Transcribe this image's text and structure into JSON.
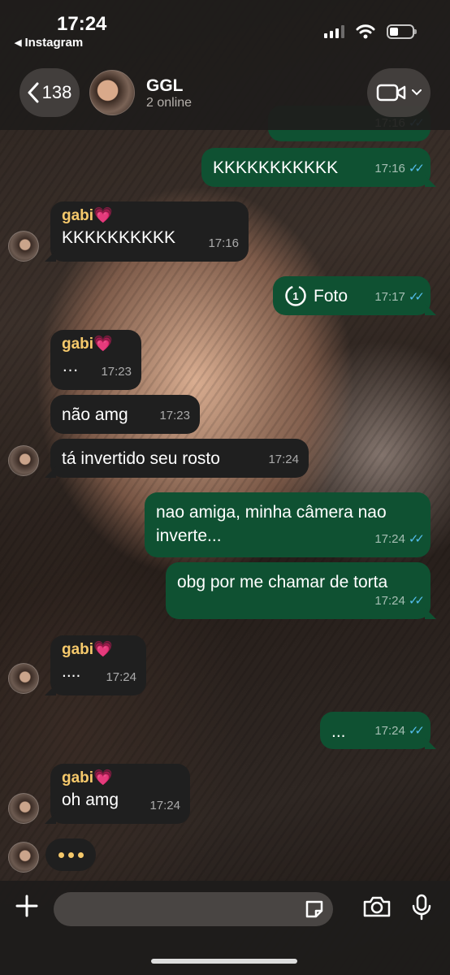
{
  "status_bar": {
    "time": "17:24",
    "back_app": "Instagram"
  },
  "chat_header": {
    "back_count": "138",
    "group_name": "GGL",
    "subtitle": "2 online"
  },
  "messages": [
    {
      "text": "KKKKKKKKKKK",
      "time": "17:16",
      "ticks": "✓✓"
    },
    {
      "sender": "gabi💗",
      "text": "KKKKKKKKKK",
      "time": "17:16"
    },
    {
      "text": "Foto",
      "time": "17:17",
      "ticks": "✓✓",
      "view_once": "1"
    },
    {
      "sender": "gabi💗",
      "text": "…",
      "time": "17:23"
    },
    {
      "text": "não amg",
      "time": "17:23"
    },
    {
      "text": "tá invertido seu rosto",
      "time": "17:24"
    },
    {
      "text": "nao amiga, minha câmera nao inverte...",
      "time": "17:24",
      "ticks": "✓✓"
    },
    {
      "text": "obg por me chamar de torta",
      "time": "17:24",
      "ticks": "✓✓"
    },
    {
      "sender": "gabi💗",
      "text": "....",
      "time": "17:24"
    },
    {
      "text": "...",
      "time": "17:24",
      "ticks": "✓✓"
    },
    {
      "sender": "gabi💗",
      "text": "oh amg",
      "time": "17:24"
    }
  ],
  "colors": {
    "outgoing_bubble": "#0f5132",
    "incoming_bubble": "#1f1f1f",
    "sender_name": "#f6c96b",
    "read_ticks": "#53bdeb"
  },
  "composer": {
    "placeholder": ""
  }
}
